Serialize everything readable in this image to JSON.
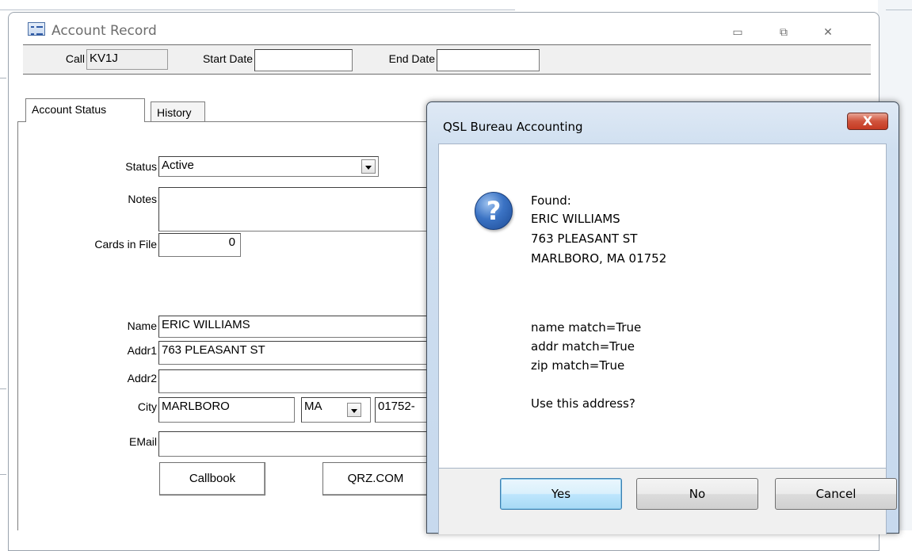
{
  "form": {
    "title": "Account Record",
    "controls": {
      "minimize": "▭",
      "restore": "⧉",
      "close": "✕"
    },
    "header": {
      "call_label": "Call",
      "call_value": "KV1J",
      "start_date_label": "Start Date",
      "start_date_value": "",
      "end_date_label": "End Date",
      "end_date_value": ""
    },
    "tabs": [
      {
        "label": "Account Status",
        "active": true
      },
      {
        "label": "History",
        "active": false
      }
    ],
    "account": {
      "status_label": "Status",
      "status_value": "Active",
      "notes_label": "Notes",
      "notes_value": "",
      "cards_label": "Cards in File",
      "cards_value": "0",
      "name_label": "Name",
      "name_value": "ERIC WILLIAMS",
      "addr1_label": "Addr1",
      "addr1_value": "763 PLEASANT ST",
      "addr2_label": "Addr2",
      "addr2_value": "",
      "city_label": "City",
      "city_value": "MARLBORO",
      "state_value": "MA",
      "zip_value": "01752-",
      "email_label": "EMail",
      "email_value": ""
    },
    "buttons": {
      "callbook": "Callbook",
      "qrz": "QRZ.COM"
    }
  },
  "dialog": {
    "title": "QSL Bureau Accounting",
    "close_glyph": "X",
    "icon": "question-icon",
    "message_lines": [
      "Found:",
      "ERIC WILLIAMS",
      "763 PLEASANT ST",
      "MARLBORO, MA 01752",
      "",
      "",
      "name match=True",
      "addr match=True",
      "zip match=True",
      "",
      "Use this address?"
    ],
    "buttons": {
      "yes": "Yes",
      "no": "No",
      "cancel": "Cancel"
    }
  },
  "colors": {
    "dialog_frame": "#cfdff0",
    "close_button": "#c63a22",
    "default_button": "#a7d9f5"
  }
}
